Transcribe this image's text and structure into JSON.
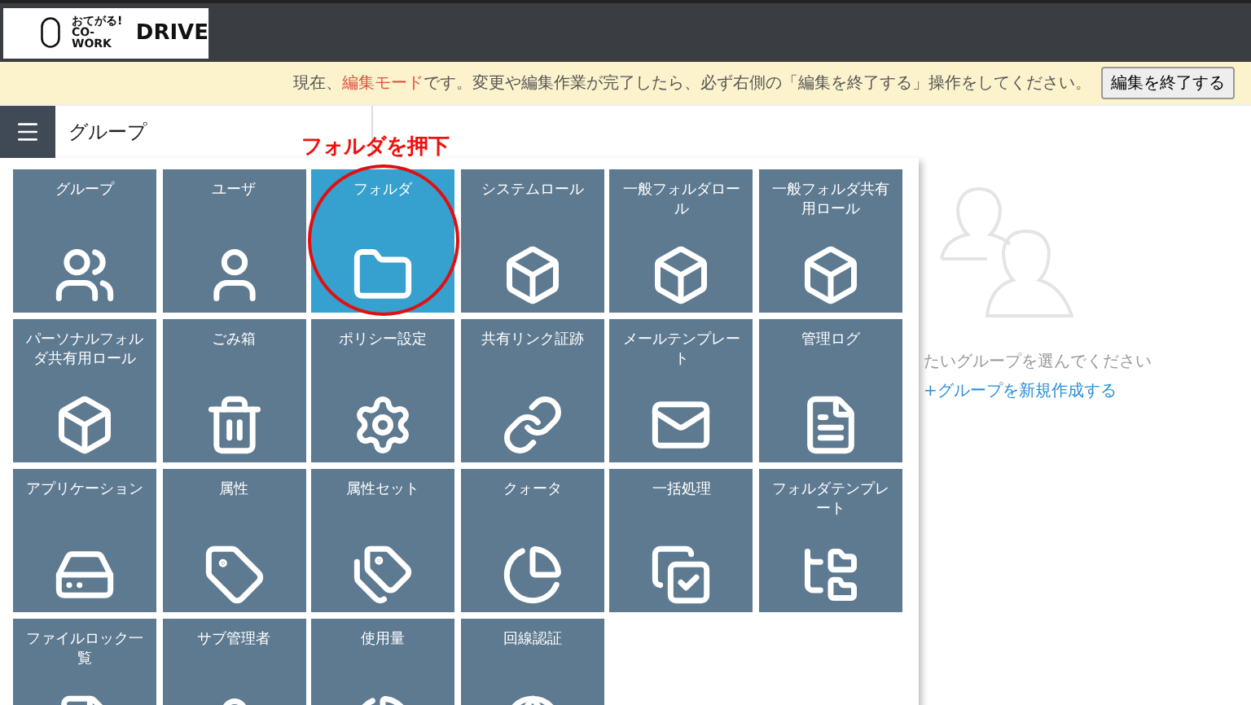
{
  "logo": {
    "tagline": "おてがる!",
    "sub": "CO-WORK",
    "name": "DRIVE"
  },
  "banner": {
    "before": "現在、",
    "highlight": "編集モード",
    "after": "です。変更や編集作業が完了したら、必ず右側の「編集を終了する」操作をしてください。",
    "button": "編集を終了する"
  },
  "sidebar": {
    "title": "グループ"
  },
  "annotation": {
    "text": "フォルダを押下"
  },
  "tiles": [
    {
      "label": "グループ",
      "selected": false
    },
    {
      "label": "ユーザ",
      "selected": false
    },
    {
      "label": "フォルダ",
      "selected": true
    },
    {
      "label": "システムロール",
      "selected": false
    },
    {
      "label": "一般フォルダロール",
      "selected": false
    },
    {
      "label": "一般フォルダ共有用ロール",
      "selected": false
    },
    {
      "label": "パーソナルフォルダ共有用ロール",
      "selected": false
    },
    {
      "label": "ごみ箱",
      "selected": false
    },
    {
      "label": "ポリシー設定",
      "selected": false
    },
    {
      "label": "共有リンク証跡",
      "selected": false
    },
    {
      "label": "メールテンプレート",
      "selected": false
    },
    {
      "label": "管理ログ",
      "selected": false
    },
    {
      "label": "アプリケーション",
      "selected": false
    },
    {
      "label": "属性",
      "selected": false
    },
    {
      "label": "属性セット",
      "selected": false
    },
    {
      "label": "クォータ",
      "selected": false
    },
    {
      "label": "一括処理",
      "selected": false
    },
    {
      "label": "フォルダテンプレート",
      "selected": false
    },
    {
      "label": "ファイルロック一覧",
      "selected": false
    },
    {
      "label": "サブ管理者",
      "selected": false
    },
    {
      "label": "使用量",
      "selected": false
    },
    {
      "label": "回線認証",
      "selected": false
    }
  ],
  "empty_state": {
    "message": "たいグループを選んでください",
    "link": "+グループを新規作成する"
  }
}
